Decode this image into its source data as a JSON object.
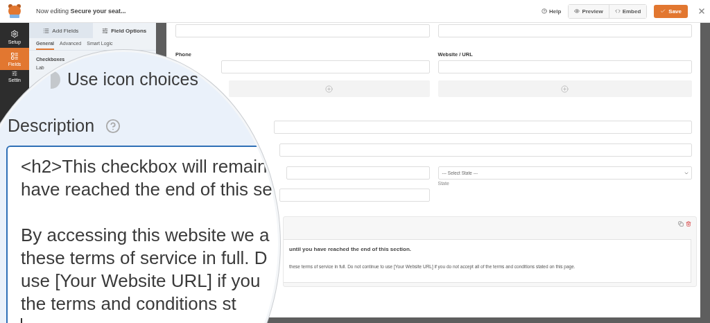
{
  "header": {
    "title": "Now editing **Secure your seat...**",
    "help": "Help",
    "preview": "Preview",
    "embed": "Embed",
    "save": "Save"
  },
  "sidebar": [
    {
      "label": "Setup",
      "selected": false
    },
    {
      "label": "Fields",
      "selected": true
    },
    {
      "label": "Settin",
      "selected": false
    }
  ],
  "panel": {
    "tabs": [
      {
        "label": "Add Fields",
        "selected": false
      },
      {
        "label": "Field Options",
        "selected": true
      }
    ],
    "subtabs": [
      {
        "label": "General",
        "selected": true
      },
      {
        "label": "Advanced",
        "selected": false
      },
      {
        "label": "Smart Logic",
        "selected": false
      }
    ],
    "field_type": "Checkboxes",
    "label_text": "Lab"
  },
  "magnifier": {
    "toggle_on": false,
    "toggle_label": "Use icon choices",
    "description_label": "Description",
    "description_paragraphs": [
      [
        "<h2>This checkbox will remain",
        "have reached the end of this se"
      ],
      [
        "By accessing this website we a",
        "these terms of service in full. D",
        "use [Your Website URL] if you",
        "the terms and conditions st"
      ]
    ]
  },
  "preview": {
    "rows": [
      {
        "kind": "pair"
      },
      {
        "kind": "pair",
        "labels": [
          "Phone",
          "Website / URL"
        ]
      },
      {
        "kind": "addrow"
      },
      {
        "kind": "full"
      },
      {
        "kind": "full"
      },
      {
        "kind": "address",
        "select": {
          "placeholder": "--- Select State ---",
          "sublabel": "State"
        }
      },
      {
        "kind": "single"
      }
    ],
    "selected_field": {
      "heading": "until you have reached the end of this section.",
      "body": "these terms of service in full. Do not continue to use [Your Website URL] if you do not accept all of the terms and conditions stated on this page."
    }
  }
}
